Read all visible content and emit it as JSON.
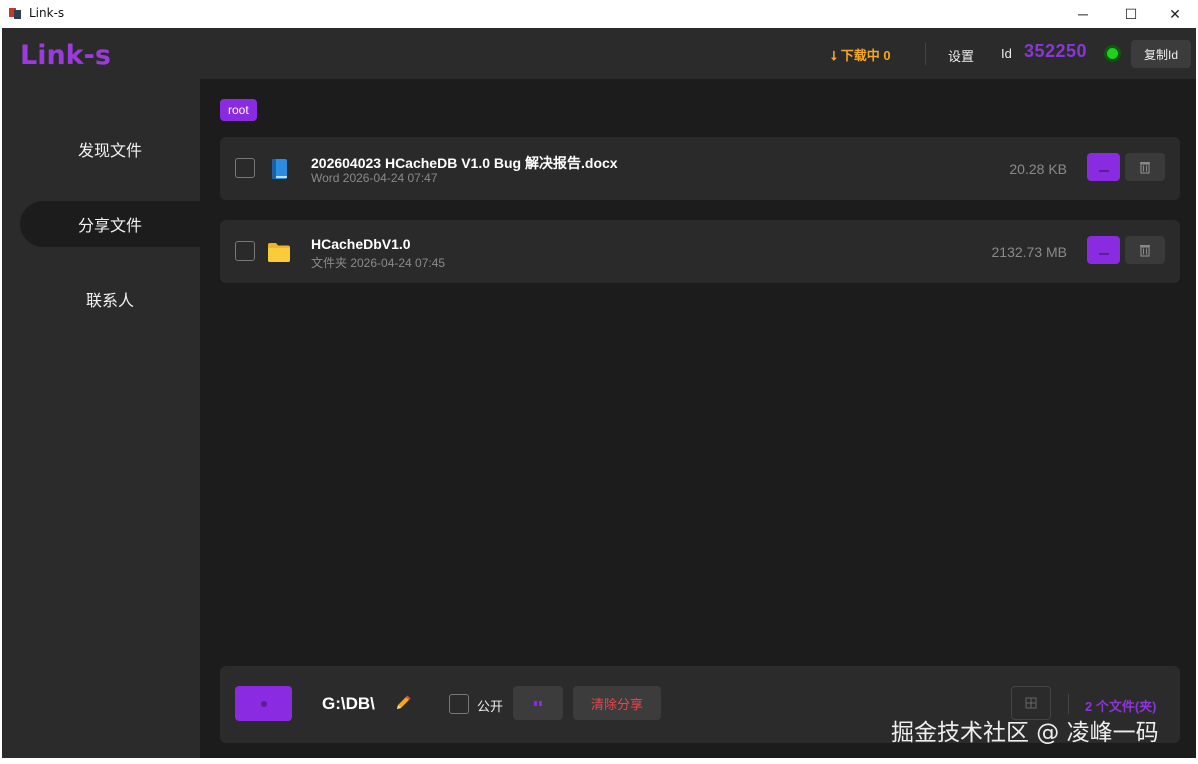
{
  "window": {
    "title": "Link-s",
    "minimize_glyph": "─",
    "maximize_glyph": "☐",
    "close_glyph": "✕"
  },
  "header": {
    "logo": "Link-s",
    "downloading": "⭣ 下载中 0",
    "settings": "设置",
    "id_label": "Id",
    "id_value": "352250",
    "copy_id": "复制Id",
    "status_color": "#1fd11f"
  },
  "sidebar": {
    "items": [
      {
        "label": "发现文件",
        "active": false
      },
      {
        "label": "分享文件",
        "active": true
      },
      {
        "label": "联系人",
        "active": false
      }
    ]
  },
  "breadcrumb": {
    "root": "root"
  },
  "files": [
    {
      "name": "202604023 HCacheDB V1.0 Bug 解决报告.docx",
      "meta": "Word 2026-04-24 07:47",
      "size": "20.28 KB",
      "icon": "book-icon"
    },
    {
      "name": "HCacheDbV1.0",
      "meta": "文件夹 2026-04-24 07:45",
      "size": "2132.73 MB",
      "icon": "folder-icon"
    }
  ],
  "bottom_bar": {
    "path": "G:\\DB\\",
    "public_label": "公开",
    "clear_share": "清除分享",
    "file_count": "2 个文件(夹)"
  },
  "colors": {
    "accent": "#8a2be2",
    "logo": "#9b3bdc",
    "warning": "#f5a623",
    "danger": "#e5484d"
  },
  "watermark": "掘金技术社区 @ 凌峰一码"
}
